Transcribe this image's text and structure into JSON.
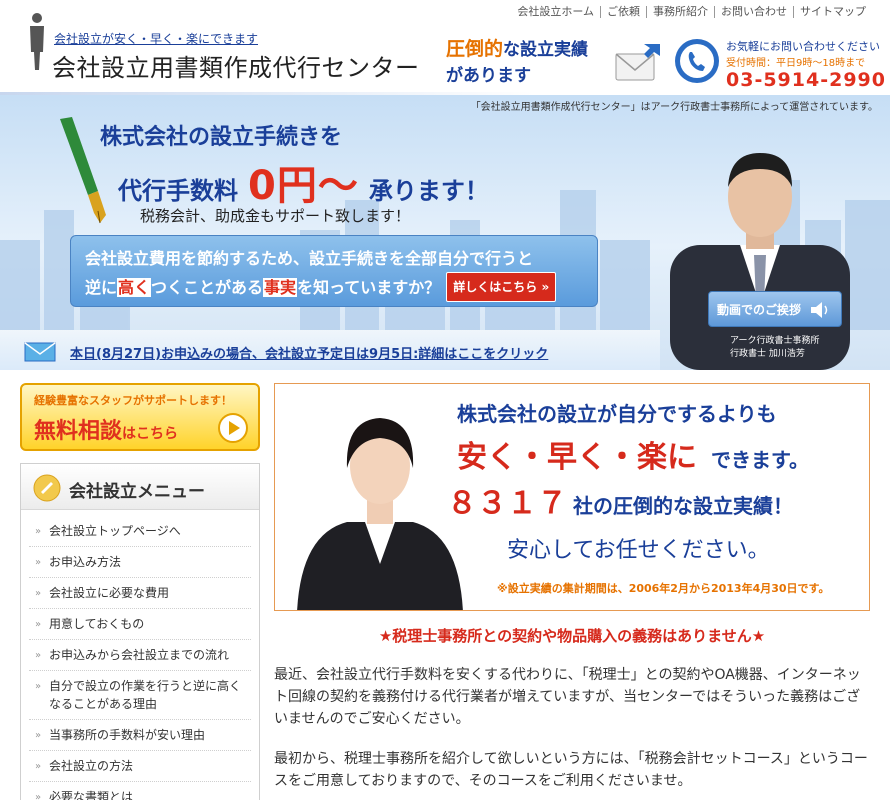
{
  "topnav": {
    "items": [
      "会社設立ホーム",
      "ご依頼",
      "事務所紹介",
      "お問い合わせ",
      "サイトマップ"
    ]
  },
  "header": {
    "tagline": "会社設立が安く・早く・楽にできます",
    "site_title": "会社設立用書類作成代行センター",
    "record_strong": "圧倒的",
    "record_rest_1": "な設立実績",
    "record_rest_2": "があります",
    "contact_note": "お気軽にお問い合わせください",
    "contact_hours": "受付時間：平日9時～18時まで",
    "phone": "03-5914-2990"
  },
  "hero": {
    "operator_note": "「会社設立用書類作成代行センター」はアーク行政書士事務所によって運営されています。",
    "headline_1": "株式会社の設立手続きを",
    "headline_2_pre": "代行手数料",
    "headline_2_price": "0円～",
    "headline_2_post": "承ります！",
    "support_line": "税務会計、助成金もサポート致します！",
    "callout_line1": "会社設立費用を節約するため、設立手続きを全部自分で行うと",
    "callout_line2_a": "逆に",
    "callout_line2_b": "高く",
    "callout_line2_c": "つくことがある",
    "callout_line2_d": "事実",
    "callout_line2_e": "を知っていますか？",
    "detail_button": "詳しくはこちら »",
    "video_button": "動画でのご挨拶",
    "caption_line1": "アーク行政書士事務所",
    "caption_line2": "行政書士 加川浩芳",
    "notice_link": "本日(8月27日)お申込みの場合、会社設立予定日は9月5日:詳細はここをクリック"
  },
  "sidebar": {
    "consult_top": "経験豊富なスタッフがサポートします！",
    "consult_main": "無料相談",
    "consult_sub": "はこちら",
    "menu_title": "会社設立メニュー",
    "menu_items": [
      "会社設立トップページへ",
      "お申込み方法",
      "会社設立に必要な費用",
      "用意しておくもの",
      "お申込みから会社設立までの流れ",
      "自分で設立の作業を行うと逆に高くなることがある理由",
      "当事務所の手数料が安い理由",
      "会社設立の方法",
      "必要な書類とは"
    ]
  },
  "main": {
    "pitch_line1": "株式会社の設立が自分でするよりも",
    "pitch_line2": "安く・早く・楽に",
    "pitch_line2_tail": "できます。",
    "pitch_line3_num": "８３１７",
    "pitch_line3_tail": "社の圧倒的な設立実績！",
    "pitch_line4": "安心してお任せください。",
    "pitch_note": "※設立実績の集計期間は、2006年2月から2013年4月30日です。",
    "no_obligation": "★税理士事務所との契約や物品購入の義務はありません★",
    "paragraph1": "最近、会社設立代行手数料を安くする代わりに、「税理士」との契約やOA機器、インターネット回線の契約を義務付ける代行業者が増えていますが、当センターではそういった義務はございませんのでご安心ください。",
    "paragraph2": "最初から、税理士事務所を紹介して欲しいという方には、「税務会計セットコース」というコースをご用意しておりますので、そのコースをご利用くださいませ。"
  },
  "colors": {
    "brand_blue": "#1a3f99",
    "accent_orange": "#e67200",
    "accent_red": "#e0301e"
  }
}
